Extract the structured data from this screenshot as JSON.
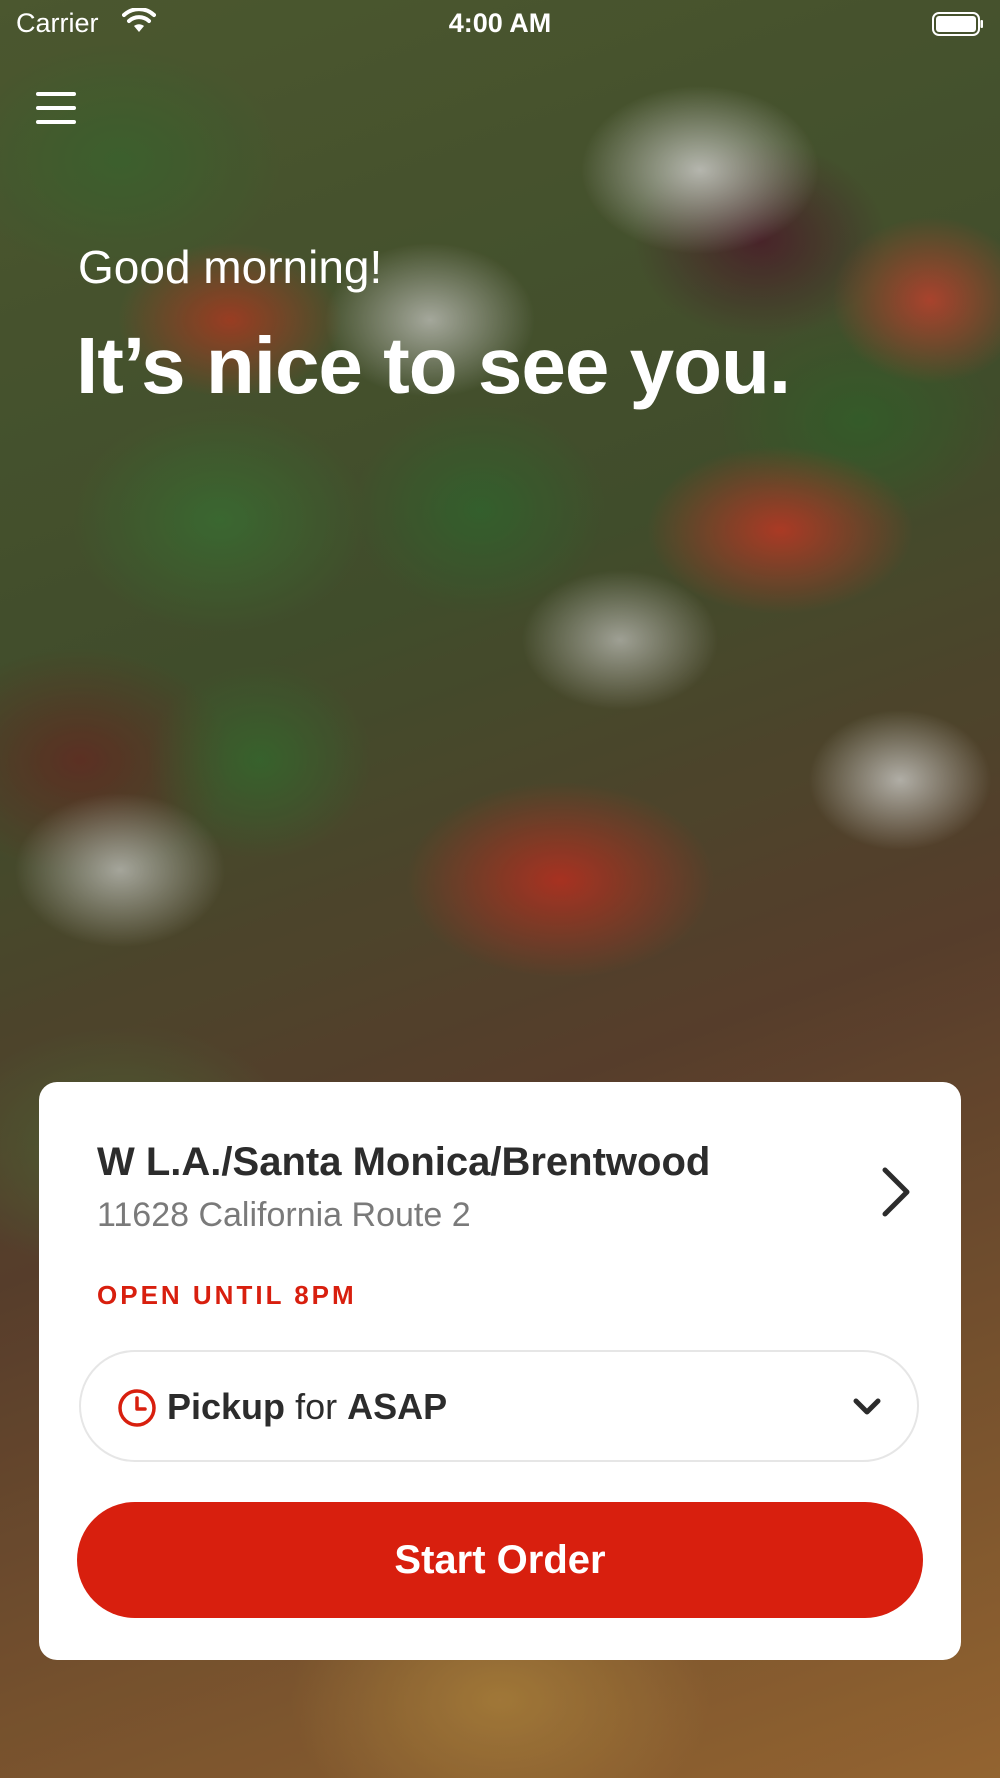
{
  "status_bar": {
    "carrier": "Carrier",
    "time": "4:00 AM"
  },
  "greeting": {
    "small": "Good morning!",
    "large": "It’s nice to see you."
  },
  "location": {
    "name": "W L.A./Santa Monica/Brentwood",
    "address": "11628 California Route 2",
    "status": "OPEN UNTIL 8PM"
  },
  "order_mode": {
    "mode": "Pickup",
    "connector": "for",
    "time": "ASAP"
  },
  "cta": {
    "label": "Start Order"
  },
  "colors": {
    "accent": "#d81f0e",
    "card": "#ffffff",
    "text_primary": "#2c2c2c",
    "text_secondary": "#7a7a7a"
  },
  "icons": {
    "menu": "hamburger-menu-icon",
    "location_chevron": "chevron-right-icon",
    "clock": "clock-icon",
    "dropdown": "chevron-down-icon",
    "wifi": "wifi-icon",
    "battery": "battery-icon"
  }
}
